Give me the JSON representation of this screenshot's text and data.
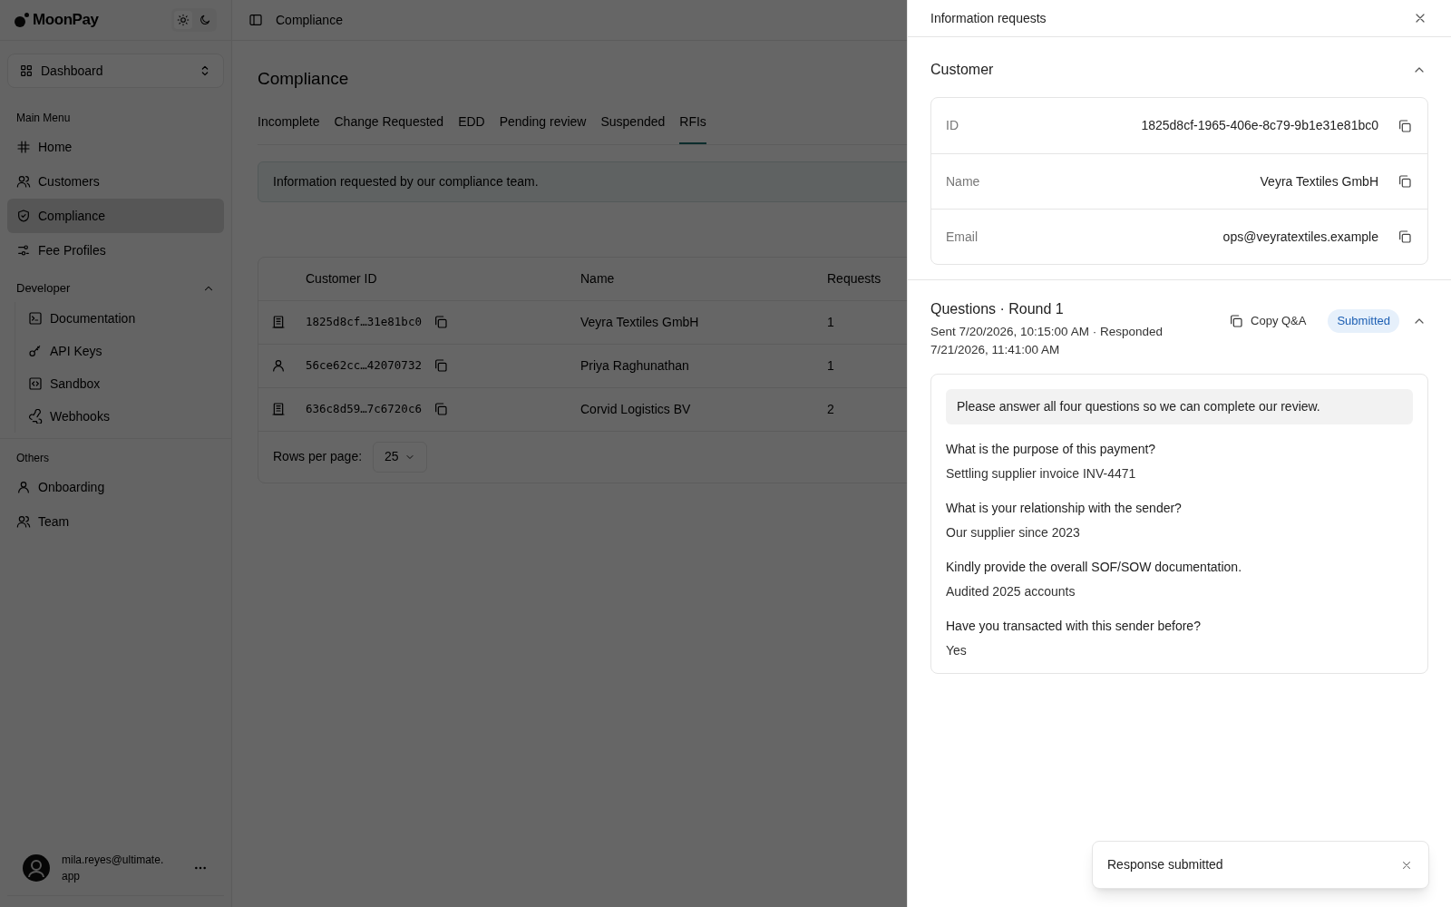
{
  "brand": "MoonPay",
  "workspace": {
    "label": "Dashboard"
  },
  "sidebar": {
    "sections": [
      {
        "title": "Main Menu",
        "items": [
          {
            "label": "Home",
            "selected": false
          },
          {
            "label": "Customers",
            "selected": false
          },
          {
            "label": "Compliance",
            "selected": true
          },
          {
            "label": "Fee Profiles",
            "selected": false
          }
        ]
      },
      {
        "title": "Developer",
        "expanded": true,
        "items": [
          {
            "label": "Documentation",
            "selected": false
          },
          {
            "label": "API Keys",
            "selected": false
          },
          {
            "label": "Sandbox",
            "selected": false
          },
          {
            "label": "Webhooks",
            "selected": false
          }
        ]
      },
      {
        "title": "Others",
        "items": [
          {
            "label": "Onboarding",
            "selected": false
          },
          {
            "label": "Team",
            "selected": false
          }
        ]
      }
    ]
  },
  "user": {
    "email": "mila.reyes@ultimate.\napp"
  },
  "breadcrumb": "Compliance",
  "page_title": "Compliance",
  "tabs": [
    {
      "label": "Incomplete",
      "selected": false
    },
    {
      "label": "Change Requested",
      "selected": false
    },
    {
      "label": "EDD",
      "selected": false
    },
    {
      "label": "Pending review",
      "selected": false
    },
    {
      "label": "Suspended",
      "selected": false
    },
    {
      "label": "RFIs",
      "selected": true
    }
  ],
  "notice": "Information requested by our compliance team.",
  "table": {
    "columns": [
      "Customer ID",
      "Name",
      "Requests"
    ],
    "rows": [
      {
        "kind": "business",
        "id": "1825d8cf…31e81bc0",
        "name": "Veyra Textiles GmbH",
        "requests": "1"
      },
      {
        "kind": "person",
        "id": "56ce62cc…42070732",
        "name": "Priya Raghunathan",
        "requests": "1"
      },
      {
        "kind": "business",
        "id": "636c8d59…7c6720c6",
        "name": "Corvid Logistics BV",
        "requests": "2"
      }
    ],
    "rows_per_page_label": "Rows per page:",
    "rows_per_page": "25"
  },
  "drawer": {
    "title": "Information requests",
    "customer": {
      "title": "Customer",
      "expanded": true,
      "fields": [
        {
          "label": "ID",
          "value": "1825d8cf-1965-406e-8c79-9b1e31e81bc0"
        },
        {
          "label": "Name",
          "value": "Veyra Textiles GmbH"
        },
        {
          "label": "Email",
          "value": "ops@veyratextiles.example"
        }
      ]
    },
    "questions": {
      "title": "Questions · Round 1",
      "meta": "Sent 7/20/2026, 10:15:00 AM · Responded 7/21/2026, 11:41:00 AM",
      "copy_label": "Copy Q&A",
      "status": "Submitted",
      "expanded": true,
      "message": "Please answer all four questions so we can complete our review.",
      "items": [
        {
          "question": "What is the purpose of this payment?",
          "answer": "Settling supplier invoice INV-4471"
        },
        {
          "question": "What is your relationship with the sender?",
          "answer": "Our supplier since 2023"
        },
        {
          "question": "Kindly provide the overall SOF/SOW documentation.",
          "answer": "Audited 2025 accounts"
        },
        {
          "question": "Have you transacted with this sender before?",
          "answer": "Yes"
        }
      ]
    }
  },
  "toast": {
    "message": "Response submitted"
  }
}
